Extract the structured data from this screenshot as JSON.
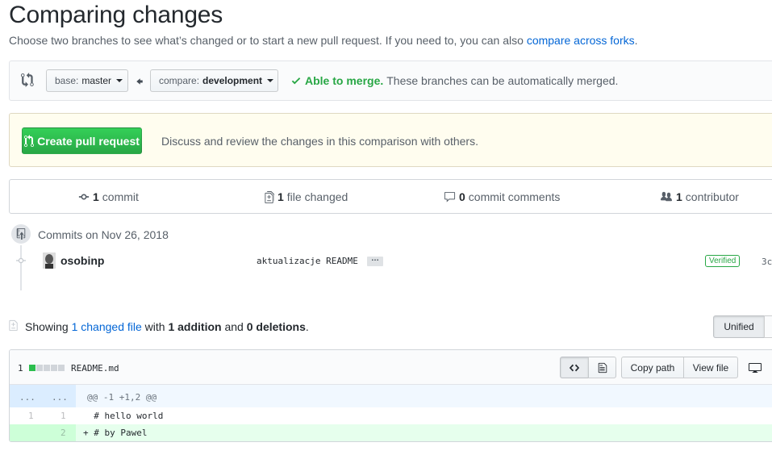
{
  "page": {
    "title": "Comparing changes",
    "subtitle_prefix": "Choose two branches to see what’s changed or to start a new pull request. If you need to, you can also ",
    "subtitle_link": "compare across forks",
    "subtitle_suffix": "."
  },
  "range": {
    "base_label": "base:",
    "base_value": "master",
    "compare_label": "compare:",
    "compare_value": "development",
    "merge_ok": "Able to merge.",
    "merge_text": "These branches can be automatically merged."
  },
  "pr": {
    "button": "Create pull request",
    "note": "Discuss and review the changes in this comparison with others."
  },
  "summary": {
    "commits_num": "1",
    "commits_label": "commit",
    "files_num": "1",
    "files_label": "file changed",
    "comments_num": "0",
    "comments_label": "commit comments",
    "contributors_num": "1",
    "contributors_label": "contributor"
  },
  "commits": {
    "date": "Commits on Nov 26, 2018",
    "items": [
      {
        "author": "osobinp",
        "message": "aktualizacje README",
        "verified": "Verified",
        "sha": "3c"
      }
    ]
  },
  "showing": {
    "prefix": "Showing ",
    "link": "1 changed file",
    "mid": " with ",
    "additions": "1 addition",
    "and": " and ",
    "deletions": "0 deletions",
    "suffix": ".",
    "unified": "Unified"
  },
  "file": {
    "diffstat": "1",
    "name": "README.md",
    "copy_path": "Copy path",
    "view_file": "View file",
    "hunk_ln_old": "...",
    "hunk_ln_new": "...",
    "hunk_header": "@@ -1 +1,2 @@",
    "lines": [
      {
        "old": "1",
        "new": "1",
        "code": "  # hello world",
        "type": "context"
      },
      {
        "old": "",
        "new": "2",
        "code": "+ # by Pawel",
        "type": "addition"
      }
    ]
  },
  "colors": {
    "green": "#28a745",
    "link": "#0366d6",
    "addition_bg": "#e6ffed",
    "addition_gutter": "#cdffd8"
  }
}
